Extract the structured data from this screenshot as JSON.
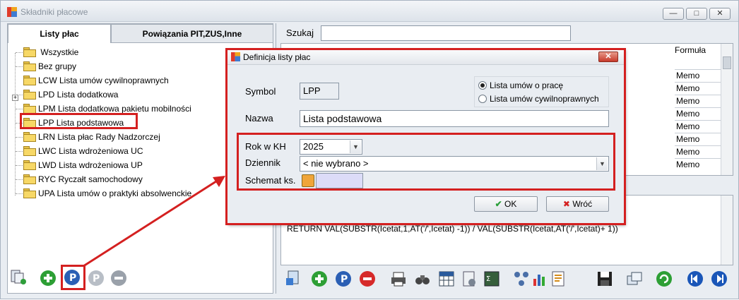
{
  "window": {
    "title": "Składniki płacowe"
  },
  "left": {
    "tabs": [
      "Listy płac",
      "Powiązania PIT,ZUS,Inne"
    ],
    "tree": [
      "Wszystkie",
      "Bez grupy",
      "LCW Lista umów cywilnoprawnych",
      "LPD Lista dodatkowa",
      "LPM Lista dodatkowa pakietu mobilności",
      "LPP Lista podstawowa",
      "LRN Lista płac Rady Nadzorczej",
      "LWC Lista wdrożeniowa UC",
      "LWD Lista wdrożeniowa UP",
      "RYC Ryczałt samochodowy",
      "UPA Lista umów o praktyki absolwenckie"
    ]
  },
  "right": {
    "search_label": "Szukaj",
    "column_formula": "Formuła",
    "memo_cells": [
      "Memo",
      "Memo",
      "Memo",
      "Memo",
      "Memo",
      "Memo",
      "Memo",
      "Memo"
    ],
    "formula_text": "RETURN VAL(SUBSTR(Icetat,1,AT('/',Icetat) -1)) / VAL(SUBSTR(Icetat,AT('/',Icetat)+ 1))"
  },
  "dialog": {
    "title": "Definicja listy płac",
    "symbol_label": "Symbol",
    "symbol_value": "LPP",
    "radio1": "Lista umów o pracę",
    "radio2": "Lista umów cywilnoprawnych",
    "nazwa_label": "Nazwa",
    "nazwa_value": "Lista podstawowa",
    "rok_label": "Rok w KH",
    "rok_value": "2025",
    "dziennik_label": "Dziennik",
    "dziennik_value": "< nie wybrano >",
    "schemat_label": "Schemat ks.",
    "ok_label": "OK",
    "cancel_label": "Wróć"
  },
  "colors": {
    "highlight": "#d42020",
    "accent": "#1a56b8"
  }
}
